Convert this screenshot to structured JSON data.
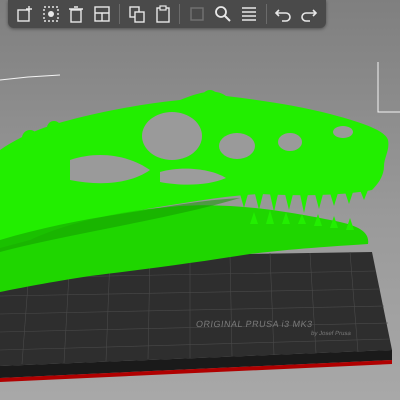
{
  "toolbar": {
    "tools": [
      {
        "name": "add-object-icon"
      },
      {
        "name": "arrange-icon"
      },
      {
        "name": "delete-icon"
      },
      {
        "name": "delete-all-icon"
      },
      {
        "name": "copy-icon"
      },
      {
        "name": "paste-icon"
      },
      {
        "name": "layers-editor-icon"
      },
      {
        "name": "search-icon"
      },
      {
        "name": "menu-icon"
      },
      {
        "name": "undo-icon"
      },
      {
        "name": "redo-icon"
      }
    ]
  },
  "bed": {
    "label": "ORIGINAL PRUSA i3 MK3",
    "sublabel": "by Josef Prusa"
  },
  "colors": {
    "model": "#22ee00",
    "model_shadow": "#149a00",
    "toolbar_bg": "#4a4a4a",
    "bed_dark": "#2c2c2c",
    "bed_edge": "#c40000"
  }
}
